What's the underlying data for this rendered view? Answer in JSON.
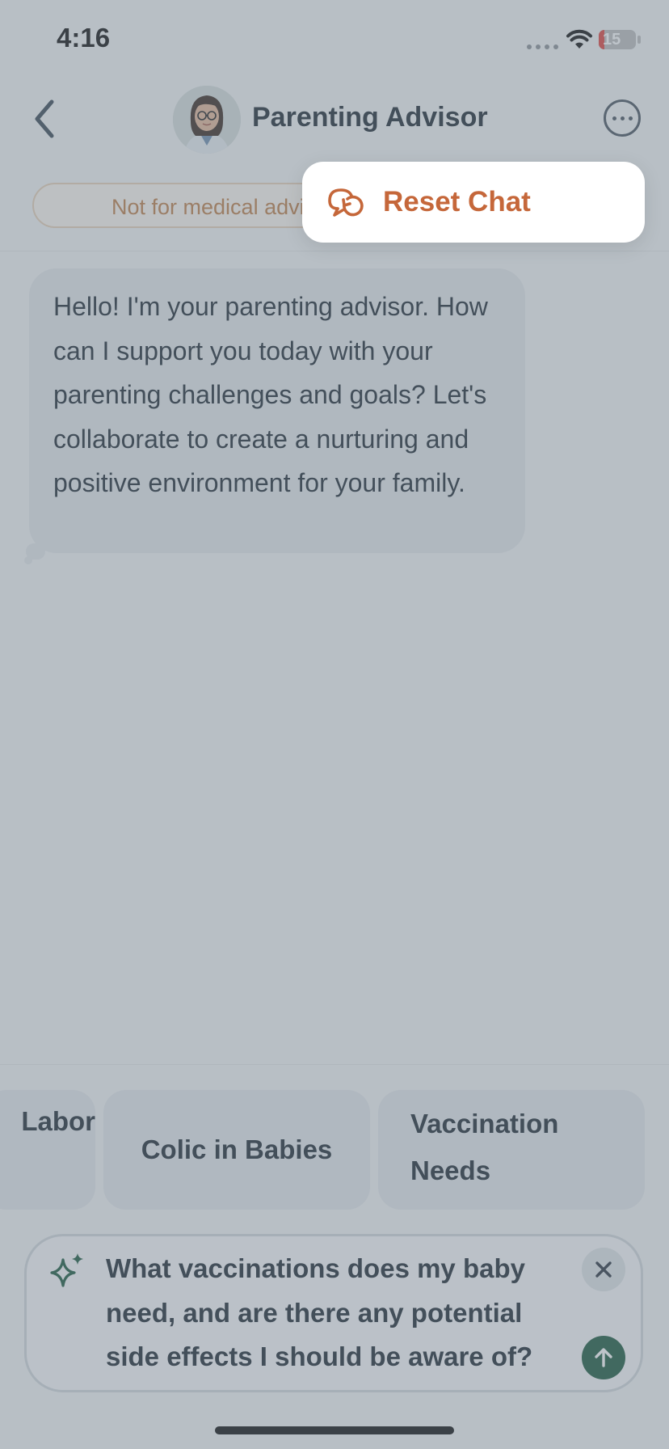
{
  "status_bar": {
    "time": "4:16",
    "battery": "15",
    "battery_level": 0.15,
    "battery_color": "#e0443e"
  },
  "header": {
    "title": "Parenting Advisor",
    "back_icon": "chevron-left-icon",
    "more_icon": "ellipsis-circle-icon",
    "avatar": "advisor-avatar"
  },
  "disclaimer": {
    "text": "Not for medical advice"
  },
  "messages": [
    {
      "sender": "advisor",
      "text": "Hello! I'm your parenting advisor. How can I support you today with your parenting challenges and goals? Let's collaborate to create a nurturing and positive environment for your family."
    }
  ],
  "suggestions": [
    {
      "label": "Labor"
    },
    {
      "label": "Colic in Babies"
    },
    {
      "label": "Vaccination Needs"
    }
  ],
  "composer": {
    "text": "What vaccinations does my baby need, and are there any potential side effects I should be aware of?",
    "sparkle_icon": "sparkle-icon",
    "clear_icon": "close-icon",
    "send_icon": "arrow-up-icon"
  },
  "menu": {
    "items": [
      {
        "label": "Reset Chat",
        "icon": "reset-chat-icon"
      }
    ]
  },
  "colors": {
    "accent": "#c5673a",
    "send_button": "#1d5a3e",
    "sparkle": "#1d5a3e"
  }
}
